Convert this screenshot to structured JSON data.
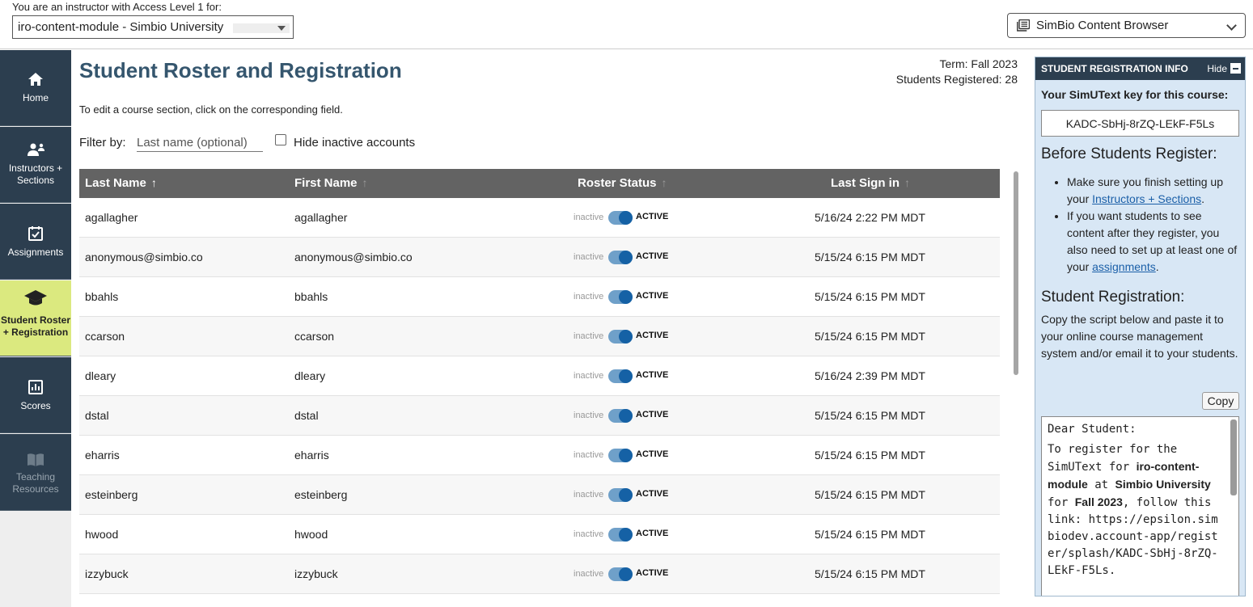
{
  "top": {
    "access_label": "You are an instructor with Access Level 1 for:",
    "course_select_value": "iro-content-module - Simbio University",
    "content_browser_label": "SimBio Content Browser"
  },
  "sidebar": {
    "items": [
      {
        "label": "Home",
        "icon": "home-icon"
      },
      {
        "label": "Instructors + Sections",
        "icon": "instructors-icon"
      },
      {
        "label": "Assignments",
        "icon": "calendar-check-icon"
      },
      {
        "label": "Student Roster + Registration",
        "icon": "graduation-cap-icon",
        "active": true
      },
      {
        "label": "Scores",
        "icon": "chart-icon"
      },
      {
        "label": "Teaching Resources",
        "icon": "book-icon",
        "disabled": true
      }
    ]
  },
  "main": {
    "title": "Student Roster and Registration",
    "term": "Term: Fall 2023",
    "students_registered": "Students Registered: 28",
    "edit_hint": "To edit a course section, click on the corresponding field.",
    "filter_label": "Filter by:",
    "filter_placeholder": "Last name (optional)",
    "hide_inactive_label": "Hide inactive accounts",
    "columns": [
      "Last Name",
      "First Name",
      "Roster Status",
      "Last Sign in"
    ],
    "status_off_label": "inactive",
    "status_on_label": "ACTIVE",
    "rows": [
      {
        "last": "agallagher",
        "first": "agallagher",
        "signin": "5/16/24 2:22 PM MDT"
      },
      {
        "last": "anonymous@simbio.co",
        "first": "anonymous@simbio.co",
        "signin": "5/15/24 6:15 PM MDT"
      },
      {
        "last": "bbahls",
        "first": "bbahls",
        "signin": "5/15/24 6:15 PM MDT"
      },
      {
        "last": "ccarson",
        "first": "ccarson",
        "signin": "5/15/24 6:15 PM MDT"
      },
      {
        "last": "dleary",
        "first": "dleary",
        "signin": "5/16/24 2:39 PM MDT"
      },
      {
        "last": "dstal",
        "first": "dstal",
        "signin": "5/15/24 6:15 PM MDT"
      },
      {
        "last": "eharris",
        "first": "eharris",
        "signin": "5/15/24 6:15 PM MDT"
      },
      {
        "last": "esteinberg",
        "first": "esteinberg",
        "signin": "5/15/24 6:15 PM MDT"
      },
      {
        "last": "hwood",
        "first": "hwood",
        "signin": "5/15/24 6:15 PM MDT"
      },
      {
        "last": "izzybuck",
        "first": "izzybuck",
        "signin": "5/15/24 6:15 PM MDT"
      }
    ]
  },
  "info": {
    "header": "STUDENT REGISTRATION INFO",
    "hide_label": "Hide",
    "key_heading": "Your SimUText key for this course:",
    "key": "KADC-SbHj-8rZQ-LEkF-F5Ls",
    "before_heading": "Before Students Register:",
    "bullet1_pre": "Make sure you finish setting up your ",
    "bullet1_link": "Instructors + Sections",
    "bullet1_post": ".",
    "bullet2_pre": "If you want students to see content after they register, you also need to set up at least one of your ",
    "bullet2_link": "assignments",
    "bullet2_post": ".",
    "reg_heading": "Student Registration:",
    "reg_text": "Copy the script below and paste it to your online course management system and/or email it to your students.",
    "copy_label": "Copy",
    "letter_greeting": "Dear Student:",
    "letter_p1": "To register for the SimUText for",
    "letter_course": "iro-content-module",
    "letter_at": "at",
    "letter_school": "Simbio University",
    "letter_for": "for",
    "letter_term": "Fall 2023",
    "letter_follow": ", follow this link:",
    "letter_link": "https://epsilon.simbiodev.account-app/register/splash/KADC-SbHj-8rZQ-LEkF-F5Ls."
  },
  "colors": {
    "nav_bg": "#2c3e4f",
    "nav_active": "#dbe97f",
    "title": "#35566e",
    "table_header": "#636363",
    "toggle_on": "#1561a5",
    "panel_bg": "#d8e7f5"
  }
}
